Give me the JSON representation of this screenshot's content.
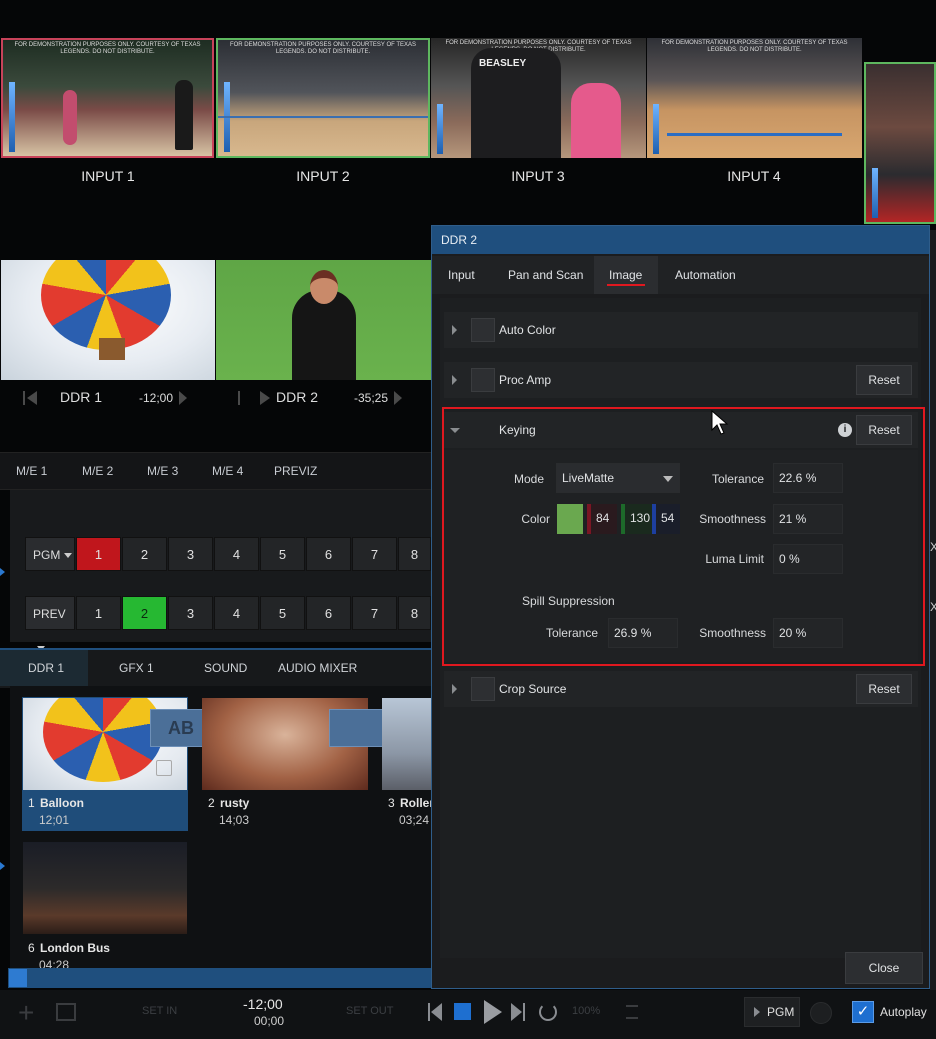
{
  "inputs": [
    {
      "label": "INPUT 1",
      "caption": "FOR DEMONSTRATION PURPOSES ONLY. COURTESY OF TEXAS LEGENDS. DO NOT DISTRIBUTE."
    },
    {
      "label": "INPUT 2",
      "caption": "FOR DEMONSTRATION PURPOSES ONLY. COURTESY OF TEXAS LEGENDS. DO NOT DISTRIBUTE."
    },
    {
      "label": "INPUT 3",
      "caption": "FOR DEMONSTRATION PURPOSES ONLY. COURTESY OF TEXAS LEGENDS. DO NOT DISTRIBUTE.",
      "jersey": "BEASLEY"
    },
    {
      "label": "INPUT 4",
      "caption": "FOR DEMONSTRATION PURPOSES ONLY. COURTESY OF TEXAS LEGENDS. DO NOT DISTRIBUTE."
    }
  ],
  "ddr_monitors": [
    {
      "label": "DDR 1",
      "time": "-12;00"
    },
    {
      "label": "DDR 2",
      "time": "-35;25"
    }
  ],
  "me_tabs": [
    "M/E 1",
    "M/E 2",
    "M/E 3",
    "M/E 4",
    "PREVIZ"
  ],
  "switcher": {
    "pgm_label": "PGM",
    "prev_label": "PREV",
    "buttons": [
      "1",
      "2",
      "3",
      "4",
      "5",
      "6",
      "7",
      "8"
    ],
    "pgm_active": "1",
    "prev_active": "2",
    "colors": {
      "pgm_active": "#c0161c",
      "prev_active": "#26b832"
    }
  },
  "bottom_tabs": [
    "DDR 1",
    "GFX 1",
    "SOUND",
    "AUDIO MIXER"
  ],
  "media": [
    {
      "index": "1",
      "name": "Balloon",
      "time": "12;01",
      "selected": true
    },
    {
      "index": "2",
      "name": "rusty",
      "time": "14;03"
    },
    {
      "index": "3",
      "name": "Roller",
      "time": "03;24"
    },
    {
      "index": "6",
      "name": "London Bus",
      "time": "04;28"
    }
  ],
  "transport": {
    "set_in": "SET IN",
    "set_out": "SET OUT",
    "time_main": "-12;00",
    "time_sub": "00;00",
    "speed": "100%",
    "pgm": "PGM",
    "autoplay": "Autoplay",
    "autoplay_checked": true
  },
  "dialog": {
    "title": "DDR 2",
    "tabs": [
      "Input",
      "Pan and Scan",
      "Image",
      "Automation"
    ],
    "active_tab": "Image",
    "sections": {
      "auto_color": "Auto Color",
      "proc_amp": "Proc Amp",
      "keying": "Keying",
      "crop_source": "Crop Source"
    },
    "reset_label": "Reset",
    "info_icon": "i",
    "keying": {
      "mode_label": "Mode",
      "mode_value": "LiveMatte",
      "color_label": "Color",
      "color_swatch": "#6aa84f",
      "color_r": "84",
      "color_g": "130",
      "color_b": "54",
      "tolerance_label": "Tolerance",
      "tolerance_value": "22.6 %",
      "smoothness_label": "Smoothness",
      "smoothness_value": "21 %",
      "luma_label": "Luma Limit",
      "luma_value": "0 %",
      "spill_label": "Spill Suppression",
      "spill_tolerance_label": "Tolerance",
      "spill_tolerance_value": "26.9 %",
      "spill_smoothness_label": "Smoothness",
      "spill_smoothness_value": "20 %"
    },
    "close_label": "Close",
    "highlight_color": "#e0181f"
  }
}
